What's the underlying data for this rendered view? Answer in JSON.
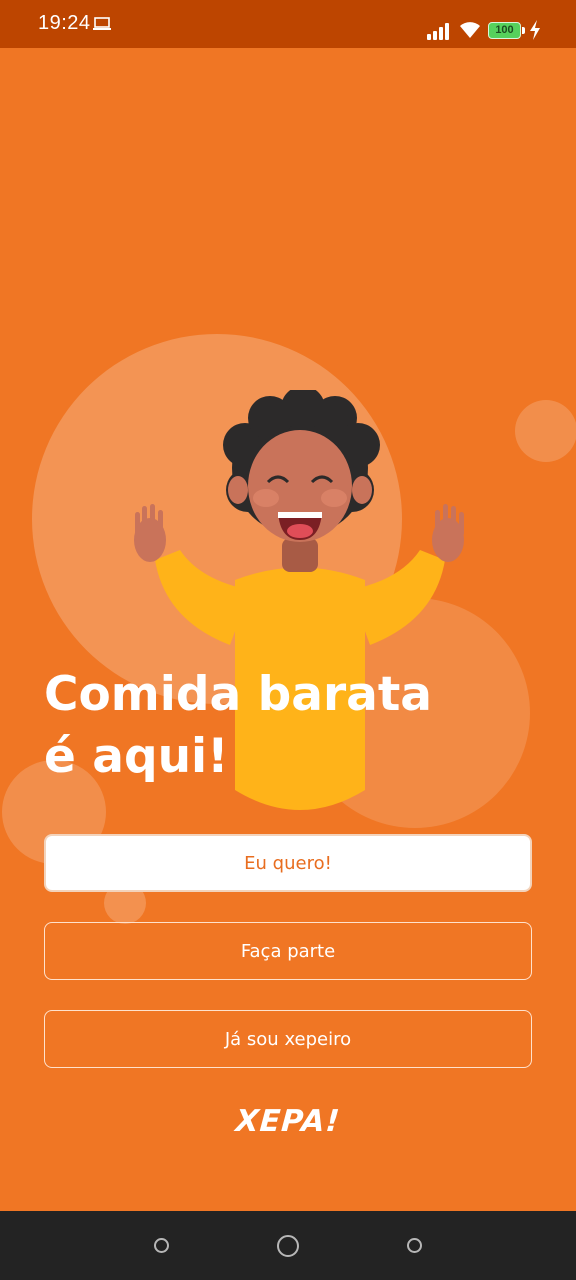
{
  "status_bar": {
    "time": "19:24",
    "battery_level": "100",
    "icons": [
      "laptop-icon",
      "signal-icon",
      "wifi-icon",
      "battery-icon",
      "charging-bolt-icon"
    ]
  },
  "hero": {
    "illustration": "cheering-person-illustration",
    "headline_line1": "Comida barata",
    "headline_line2": "é aqui!"
  },
  "actions": {
    "primary_label": "Eu quero!",
    "join_label": "Faça parte",
    "login_label": "Já sou xepeiro"
  },
  "brand": {
    "logo_text": "XEPA!"
  },
  "nav_bar": {
    "icons": [
      "back-button-icon",
      "home-button-icon",
      "recents-button-icon"
    ]
  },
  "colors": {
    "background": "#f07624",
    "status_bar": "#bd4500",
    "primary_text": "#e86d1f",
    "shirt": "#ffb319",
    "nav_bar": "#232323"
  }
}
